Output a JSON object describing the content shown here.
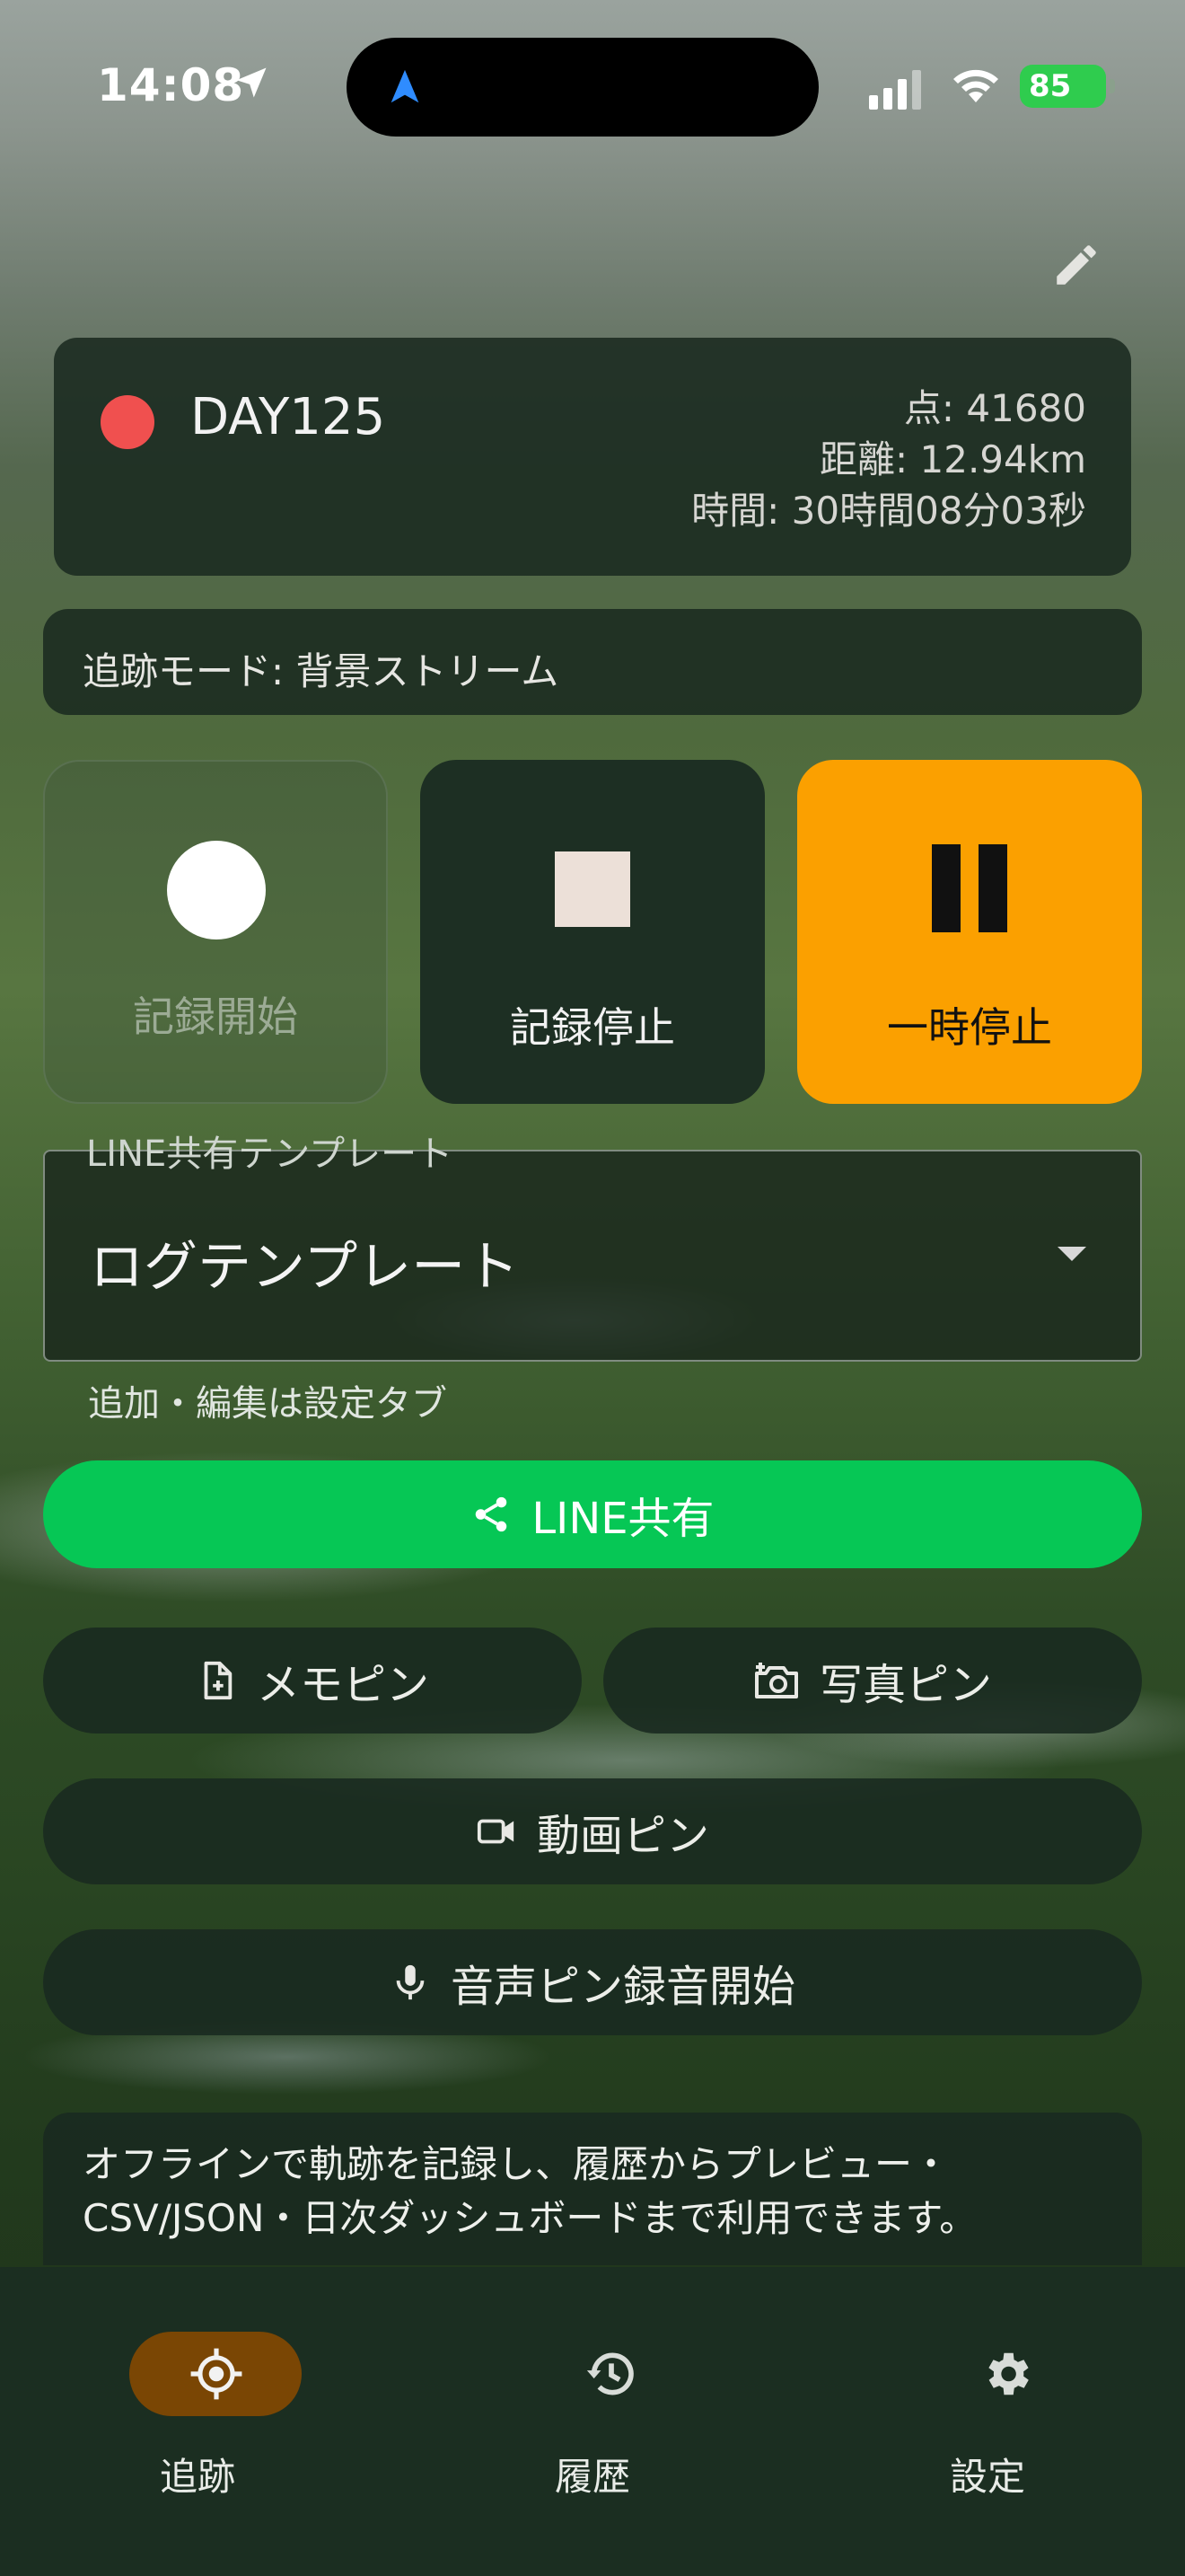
{
  "status_bar": {
    "time": "14:08",
    "battery": "85"
  },
  "record": {
    "title": "DAY125",
    "points": "点: 41680",
    "distance": "距離: 12.94km",
    "duration": "時間: 30時間08分03秒"
  },
  "mode": {
    "text": "追跡モード: 背景ストリーム"
  },
  "controls": {
    "start_label": "記録開始",
    "stop_label": "記録停止",
    "pause_label": "一時停止"
  },
  "template": {
    "label": "LINE共有テンプレート",
    "value": "ログテンプレート",
    "helper": "追加・編集は設定タブ"
  },
  "actions": {
    "line_share": "LINE共有",
    "memo_pin": "メモピン",
    "photo_pin": "写真ピン",
    "video_pin": "動画ピン",
    "voice_pin": "音声ピン録音開始"
  },
  "info": {
    "text": "オフラインで軌跡を記録し、履歴からプレビュー・CSV/JSON・日次ダッシュボードまで利用できます。"
  },
  "nav": {
    "track": "追跡",
    "history": "履歴",
    "settings": "設定"
  },
  "colors": {
    "accent_orange": "#fba000",
    "line_green": "#06c755",
    "record_red": "#f0504f",
    "nav_active": "#7a4604"
  },
  "icons": [
    "location-arrow-icon",
    "navigation-icon",
    "signal-icon",
    "wifi-icon",
    "battery-icon",
    "edit-pencil-icon",
    "share-icon",
    "note-add-icon",
    "camera-plus-icon",
    "video-camera-icon",
    "microphone-icon",
    "gps-target-icon",
    "history-icon",
    "gear-icon"
  ]
}
